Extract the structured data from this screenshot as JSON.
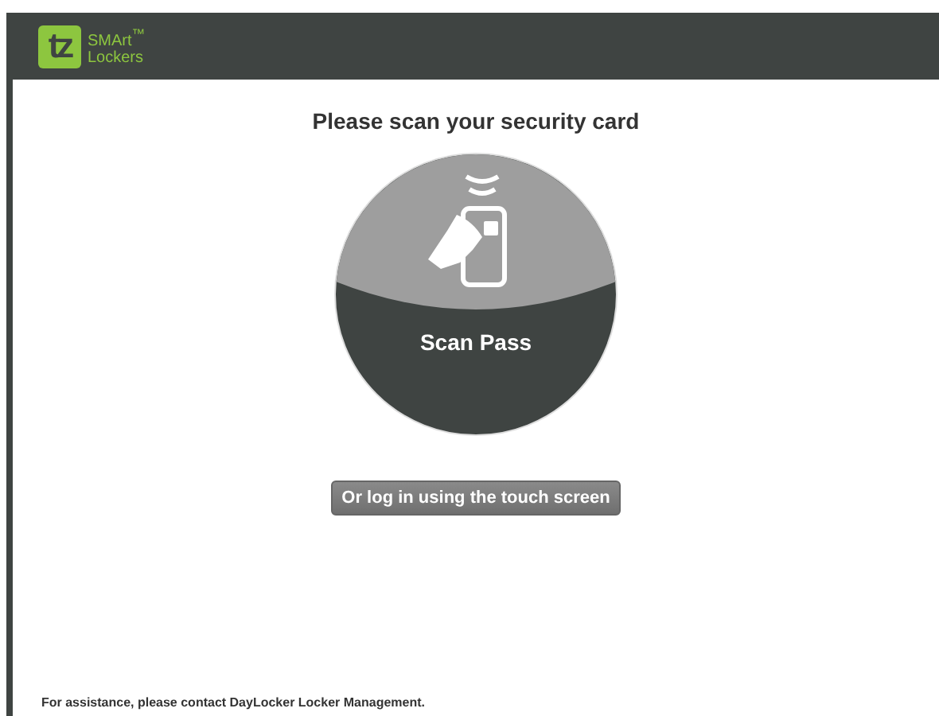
{
  "header": {
    "logo": {
      "mark": "tz",
      "name": "SMArt$^{™}$",
      "tagline": "Lockers"
    }
  },
  "title": "Please scan your security card",
  "scan": {
    "label": "Scan Pass"
  },
  "buttons": [
    {
      "label": "Or log in using the touch screen"
    }
  ],
  "footer": "For assistance, please contact DayLocker Locker Management."
}
